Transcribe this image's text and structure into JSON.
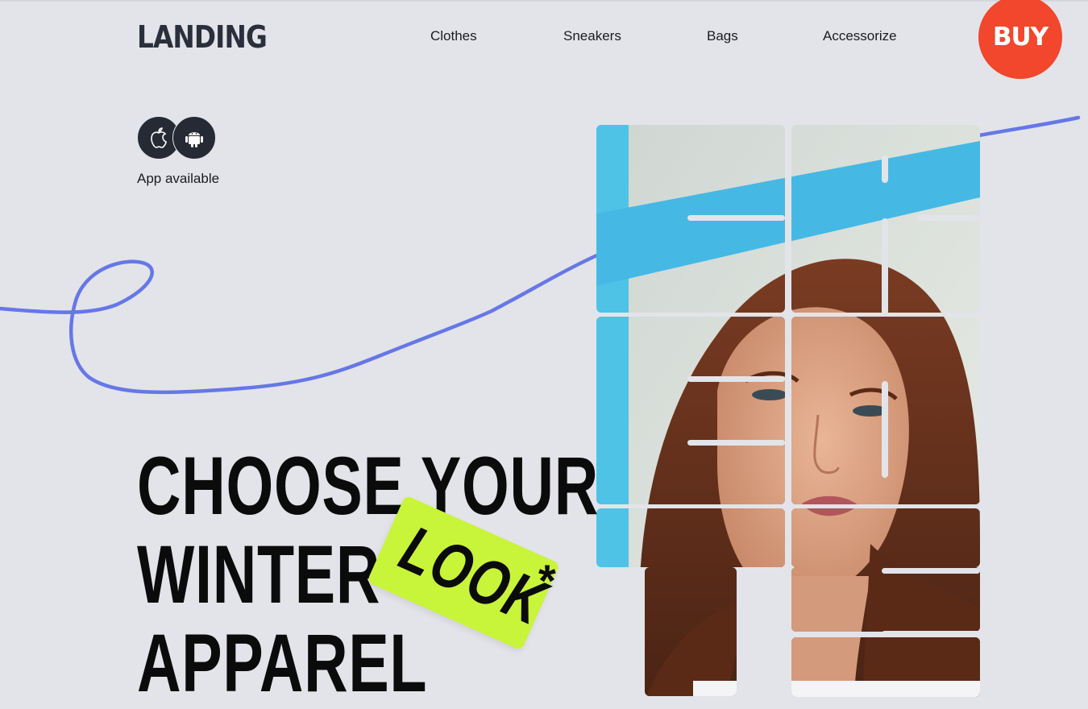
{
  "header": {
    "logo": "LANDING",
    "nav": [
      {
        "label": "Clothes"
      },
      {
        "label": "Sneakers"
      },
      {
        "label": "Bags"
      },
      {
        "label": "Accessorize"
      }
    ],
    "buy_label": "BUY"
  },
  "apps": {
    "label": "App available",
    "icons": [
      "apple-icon",
      "android-icon"
    ]
  },
  "hero": {
    "line1": "CHOOSE YOUR",
    "line2": "WINTER",
    "line3": "APPAREL",
    "tag": "LOOK",
    "asterisk": "*"
  },
  "colors": {
    "background": "#e3e4e9",
    "buy": "#f2462d",
    "tag": "#c8f43a",
    "curve": "#6677e6",
    "icon_circle": "#262a35"
  }
}
